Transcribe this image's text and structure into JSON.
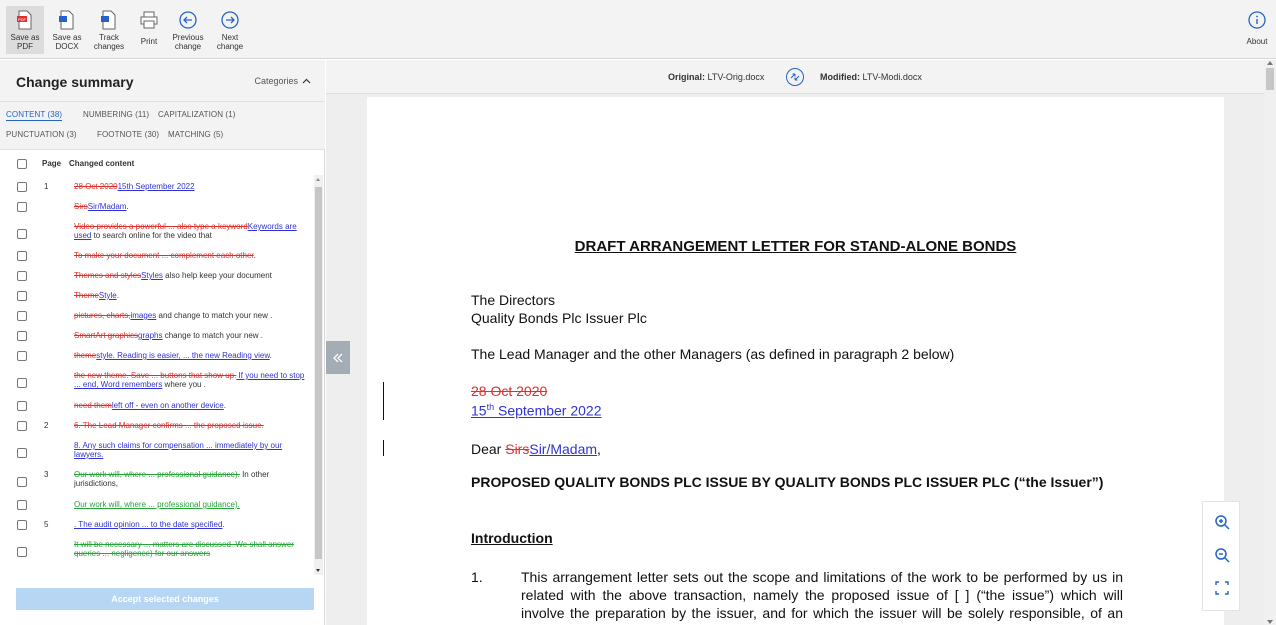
{
  "toolbar": {
    "save_pdf": "Save as\nPDF",
    "save_docx": "Save as\nDOCX",
    "track_changes": "Track\nchanges",
    "print": "Print",
    "previous_change": "Previous\nchange",
    "next_change": "Next\nchange",
    "about": "About"
  },
  "summary": {
    "title": "Change summary",
    "categories_label": "Categories",
    "tabs": [
      {
        "label": "CONTENT (38)",
        "active": true
      },
      {
        "label": "NUMBERING (11)"
      },
      {
        "label": "CAPITALIZATION (1)"
      },
      {
        "label": "PUNCTUATION (3)"
      },
      {
        "label": "FOOTNOTE (30)"
      },
      {
        "label": "MATCHING (5)"
      }
    ],
    "col_page": "Page",
    "col_content": "Changed content",
    "rows": [
      {
        "page": "1",
        "del": "28 Oct 2020",
        "ins": "15th September 2022",
        "rest": ""
      },
      {
        "page": "",
        "del": "Sirs",
        "ins": "Sir/Madam",
        "rest": "."
      },
      {
        "page": "",
        "del": "Video provides a powerful ... also type a keyword",
        "ins": "Keywords are used",
        "rest": " to search online for the video that"
      },
      {
        "page": "",
        "del": " To make your document ... complement each other",
        "ins": "",
        "rest": "."
      },
      {
        "page": "",
        "del": "Themes and styles",
        "ins": "Styles",
        "rest": " also help keep your document"
      },
      {
        "page": "",
        "del": "Theme",
        "ins": "Style",
        "rest": "."
      },
      {
        "page": "",
        "del": "pictures, charts,",
        "ins": "images",
        "rest": " and change to match your new ."
      },
      {
        "page": "",
        "del": "SmartArt graphics",
        "ins": "graphs",
        "rest": " change to match your new ."
      },
      {
        "page": "",
        "del": "theme",
        "ins": "style. Reading is easier, ... the new Reading view",
        "rest": "."
      },
      {
        "page": "",
        "del": "the new theme. Save ... buttons that show up.",
        "ins": " If you need to stop ... end, Word remembers",
        "rest": " where you ."
      },
      {
        "page": "",
        "del": "need them",
        "ins": "left off - even on another device",
        "rest": "."
      },
      {
        "page": "2",
        "del": "6. The Lead Manager confirms ... the proposed issue.",
        "ins": "",
        "rest": ""
      },
      {
        "page": "",
        "del": "",
        "ins": "8. Any such claims for compensation ... immediately by our lawyers.",
        "rest": ""
      },
      {
        "page": "3",
        "gdel": "Our work will, where ... professional guidance).",
        "rest": " In other jurisdictions,"
      },
      {
        "page": "",
        "gins": "Our work will, where ... professional guidance).",
        "rest": ""
      },
      {
        "page": "5",
        "del": "",
        "ins": ". The audit opinion ... to the date specified",
        "rest": "."
      },
      {
        "page": "",
        "gdel": "It will be necessary ... matters are discussed. We shall answer queries ... negligence) for our answers",
        "rest": ""
      }
    ],
    "accept_button": "Accept selected changes"
  },
  "filebar": {
    "original_label": "Original:",
    "original_file": "LTV-Orig.docx",
    "modified_label": "Modified:",
    "modified_file": "LTV-Modi.docx"
  },
  "document": {
    "title": "DRAFT ARRANGEMENT LETTER FOR STAND-ALONE BONDS",
    "addressee_1": "The Directors",
    "addressee_2": "Quality Bonds Plc Issuer Plc",
    "lead_manager": "The Lead Manager and the other Managers (as defined in paragraph 2 below)",
    "date_deleted": "28 Oct 2020",
    "date_inserted_day": "15",
    "date_inserted_sup": "th",
    "date_inserted_rest": " September 2022",
    "dear": "Dear ",
    "salutation_deleted": "Sirs",
    "salutation_inserted": "Sir/Madam",
    "salutation_end": ",",
    "heading": "PROPOSED QUALITY BONDS PLC ISSUE BY QUALITY BONDS PLC ISSUER PLC (“the Issuer”)",
    "intro_heading": "Introduction",
    "para_num": "1.",
    "para_text": "This arrangement letter sets out the scope and limitations of the work to be performed by us in related with the above transaction, namely the proposed issue of [ ] (“the issue”) which will involve the preparation by the issuer, and for which the issuer will be solely responsible, of an offering circular in accordance with the listing rules of the"
  },
  "colors": {
    "accent": "#2563c9",
    "deleted": "#e0302c",
    "inserted": "#2f33d6",
    "moved": "#27a33a"
  }
}
